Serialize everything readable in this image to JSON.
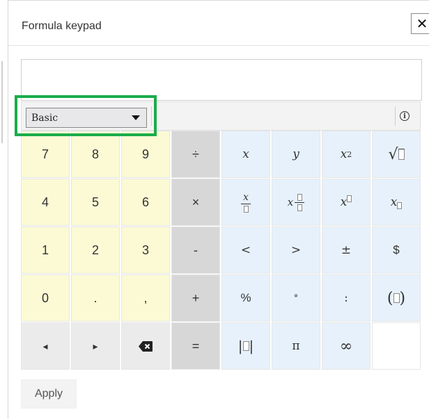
{
  "dialog": {
    "title": "Formula keypad",
    "close_label": "✕"
  },
  "input": {
    "value": ""
  },
  "toolbar": {
    "category_select": "Basic",
    "info_icon": "ⓘ"
  },
  "keys": {
    "k7": "7",
    "k8": "8",
    "k9": "9",
    "divide": "÷",
    "x": "x",
    "y": "y",
    "k4": "4",
    "k5": "5",
    "k6": "6",
    "multiply": "×",
    "k1": "1",
    "k2": "2",
    "k3": "3",
    "minus": "-",
    "less": "<",
    "greater": ">",
    "plusminus": "±",
    "dollar": "$",
    "k0": "0",
    "decimal": ".",
    "comma": ",",
    "plus": "+",
    "percent": "%",
    "degree": "°",
    "colon": ":",
    "left": "◂",
    "right": "▸",
    "equals": "=",
    "pi": "π",
    "infinity": "∞"
  },
  "footer": {
    "apply_label": "Apply"
  },
  "colors": {
    "highlight": "#1aad4a",
    "numeric_keys": "#fbfad5",
    "operator_keys": "#d7d7d7",
    "variable_keys": "#e7f1fb"
  }
}
